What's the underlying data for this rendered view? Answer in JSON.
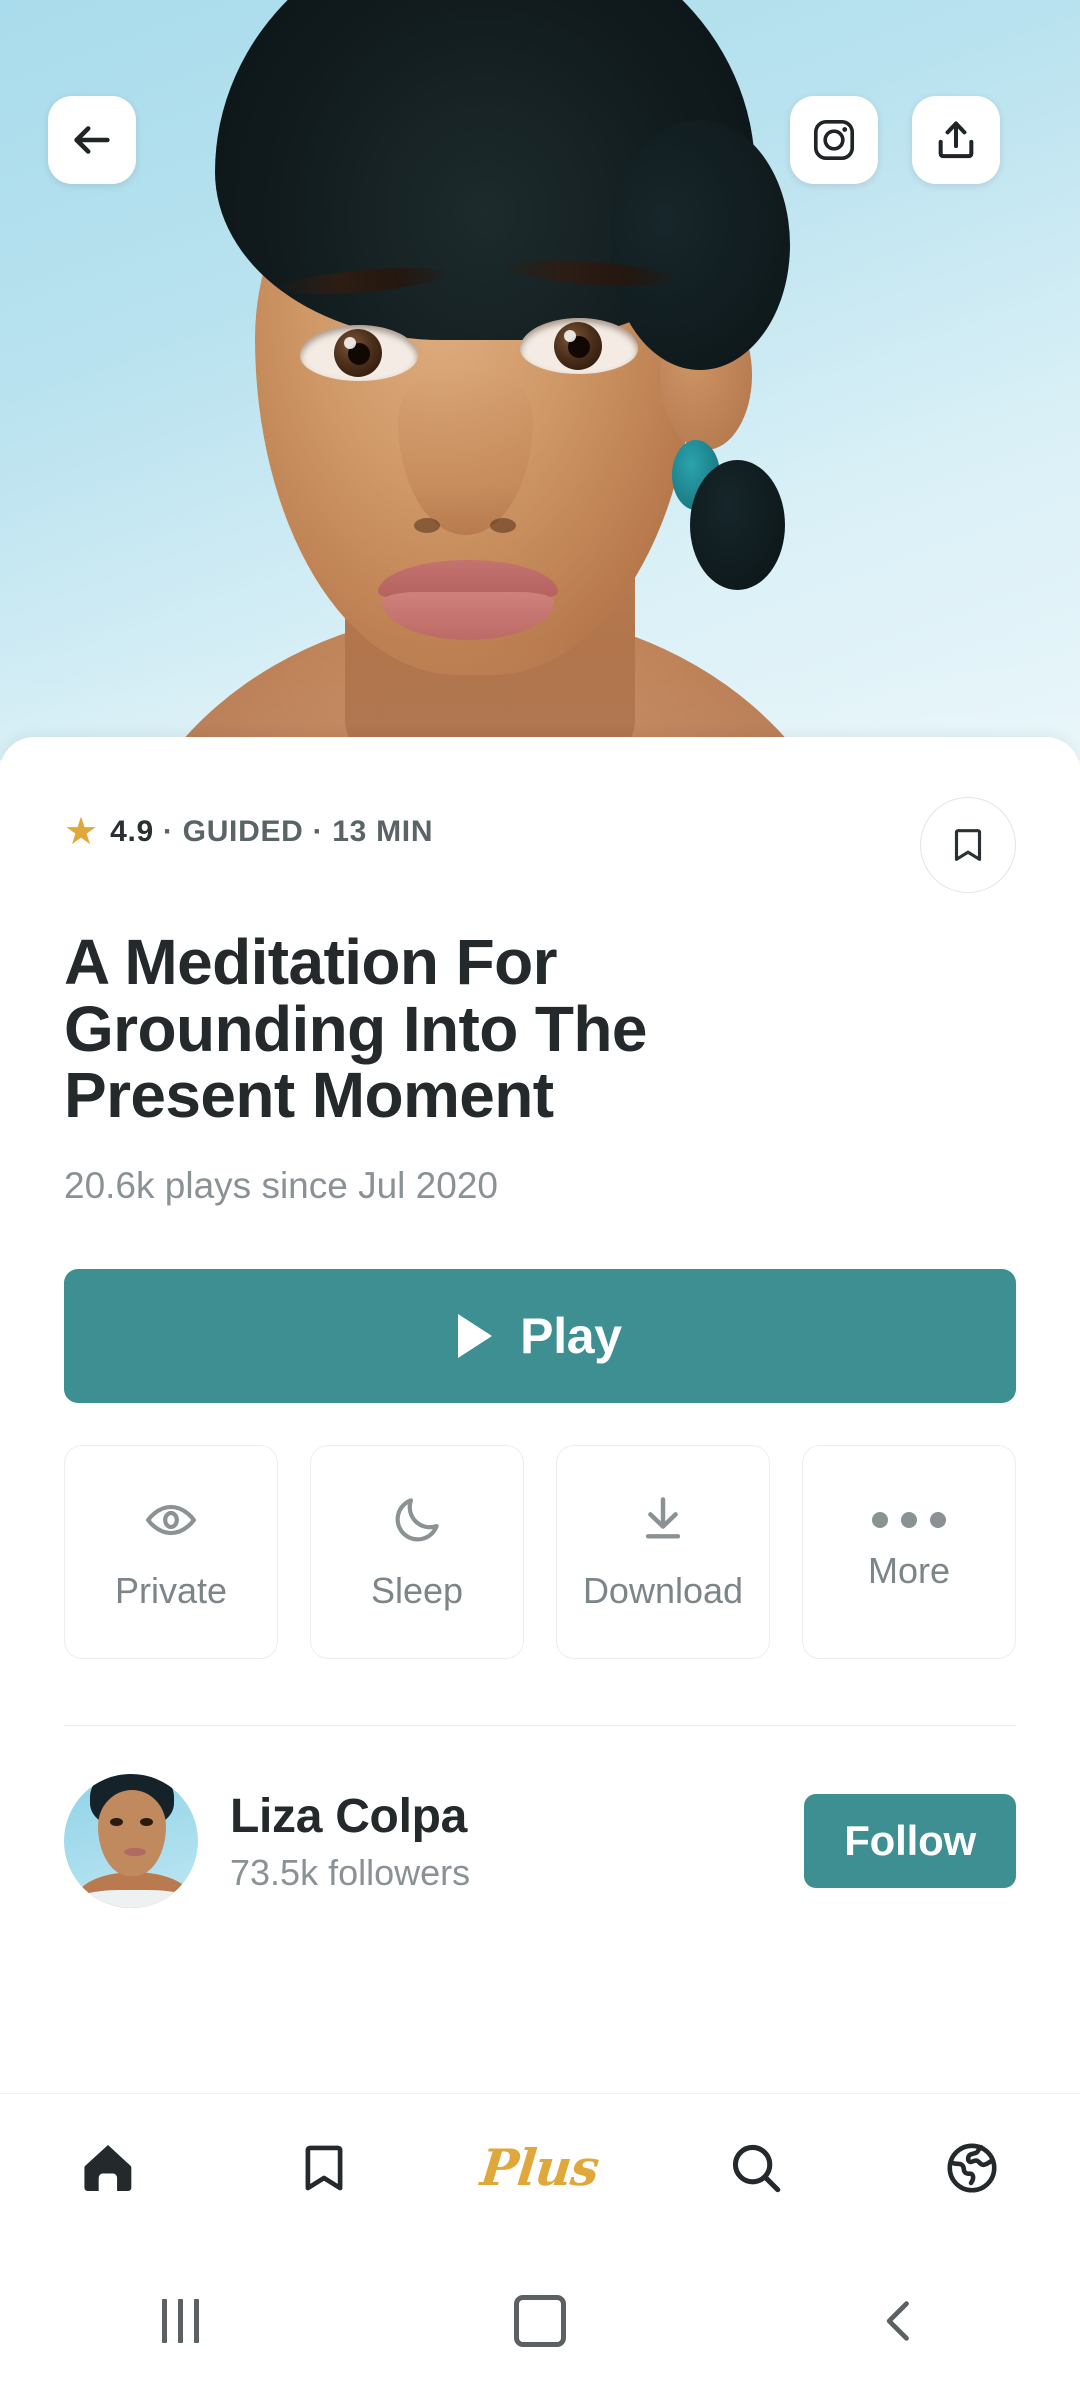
{
  "hero": {
    "back_icon": "arrow-left-icon",
    "instagram_icon": "instagram-icon",
    "share_icon": "share-upload-icon"
  },
  "detail": {
    "rating": "4.9",
    "meta_separator_1": " · ",
    "type": "GUIDED",
    "meta_separator_2": " · ",
    "duration": "13 MIN",
    "star_glyph": "★",
    "bookmark_icon": "bookmark-icon",
    "title": "A Meditation For Grounding Into The Present Moment",
    "plays": "20.6k plays since Jul 2020",
    "play_label": "Play",
    "accent_color": "#3D8F92",
    "star_color": "#E0A83A",
    "title_color": "#24292B"
  },
  "actions": [
    {
      "label": "Private",
      "icon": "eye-icon"
    },
    {
      "label": "Sleep",
      "icon": "moon-icon"
    },
    {
      "label": "Download",
      "icon": "download-icon"
    },
    {
      "label": "More",
      "icon": "ellipsis-icon"
    }
  ],
  "author": {
    "name": "Liza Colpa",
    "followers": "73.5k followers",
    "follow_label": "Follow",
    "avatar_icon": "avatar"
  },
  "bottom_nav": [
    {
      "name": "home",
      "icon": "home-icon",
      "label": ""
    },
    {
      "name": "library",
      "icon": "bookmark-icon",
      "label": ""
    },
    {
      "name": "plus",
      "icon": "plus-wordmark",
      "label": "Plus"
    },
    {
      "name": "search",
      "icon": "search-icon",
      "label": ""
    },
    {
      "name": "discover",
      "icon": "globe-icon",
      "label": ""
    }
  ],
  "system_bar": {
    "recents": "recents-icon",
    "home": "home-square-icon",
    "back": "back-chevron-icon"
  }
}
